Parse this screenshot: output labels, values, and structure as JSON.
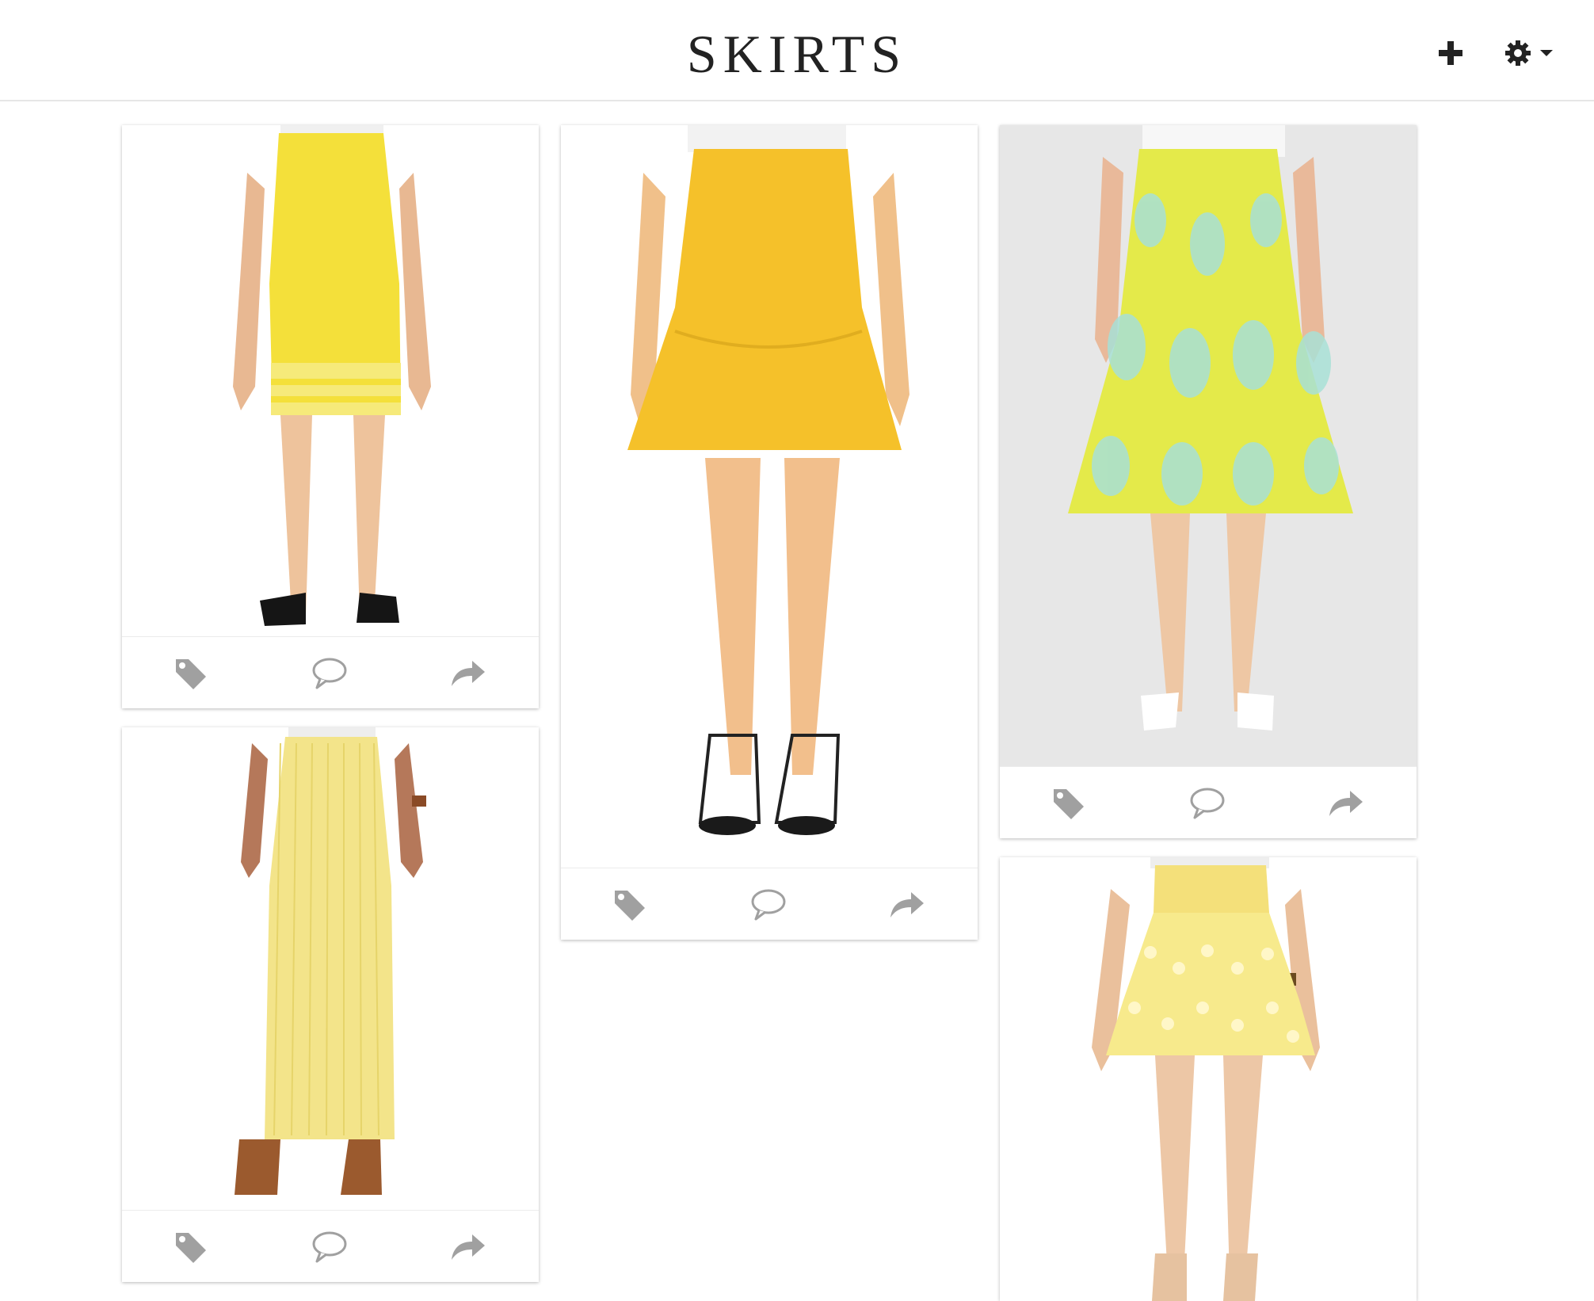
{
  "header": {
    "title": "SKIRTS",
    "add_icon": "plus-icon",
    "settings_icon": "gear-icon",
    "settings_caret_icon": "caret-down-icon"
  },
  "colors": {
    "icon_gray": "#a0a0a0",
    "header_icon": "#222222",
    "divider": "#e6e6e6"
  },
  "cards": [
    {
      "id": "pencil-skirt",
      "actions": [
        "tag-icon",
        "comment-icon",
        "share-icon"
      ]
    },
    {
      "id": "pleated-maxi-skirt",
      "actions": [
        "tag-icon",
        "comment-icon",
        "share-icon"
      ]
    },
    {
      "id": "flounce-skirt",
      "actions": [
        "tag-icon",
        "comment-icon",
        "share-icon"
      ]
    },
    {
      "id": "damask-a-line-skirt",
      "actions": [
        "tag-icon",
        "comment-icon",
        "share-icon"
      ]
    },
    {
      "id": "lace-skater-skirt",
      "actions": []
    }
  ]
}
